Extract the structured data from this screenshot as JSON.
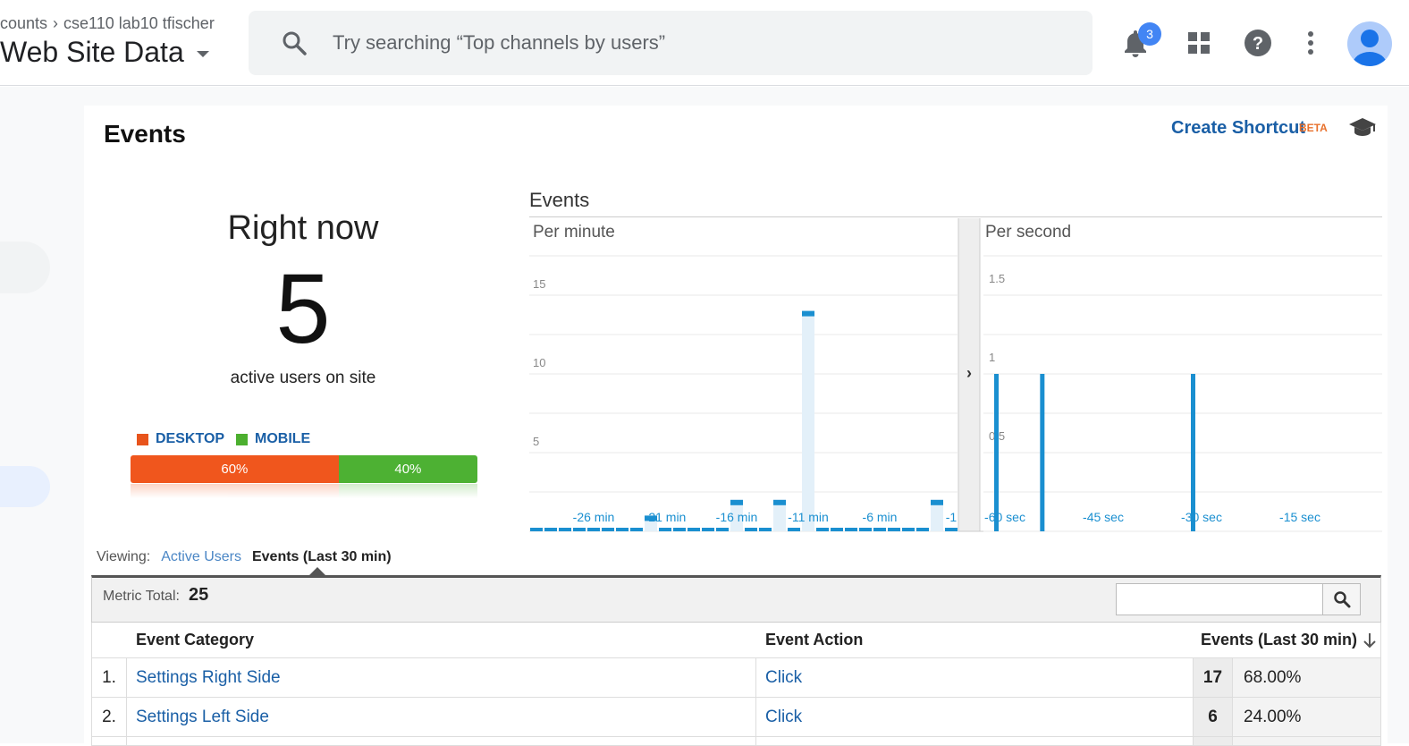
{
  "header": {
    "breadcrumb": [
      "counts",
      "cse110 lab10 tfischer"
    ],
    "property_name": "Web Site Data",
    "search_placeholder": "Try searching “Top channels by users”",
    "notification_count": "3"
  },
  "report": {
    "title": "Events",
    "create_shortcut": "Create Shortcut",
    "beta": "BETA"
  },
  "right_now": {
    "title": "Right now",
    "value": "5",
    "subtitle": "active users on site",
    "legend": [
      {
        "label": "DESKTOP",
        "color": "#e8541c"
      },
      {
        "label": "MOBILE",
        "color": "#4caf2f"
      }
    ],
    "split": [
      {
        "label": "60%",
        "value": 0.6,
        "color": "#f0561d"
      },
      {
        "label": "40%",
        "value": 0.4,
        "color": "#4db133"
      }
    ]
  },
  "chart_data": [
    {
      "type": "bar",
      "title": "Events",
      "panel_label": "Per minute",
      "yticks": [
        "5",
        "10",
        "15"
      ],
      "ylim": [
        0,
        15
      ],
      "xticks": [
        "-26 min",
        "-21 min",
        "-16 min",
        "-11 min",
        "-6 min",
        "-1"
      ],
      "x": [
        -30,
        -29,
        -28,
        -27,
        -26,
        -25,
        -24,
        -23,
        -22,
        -21,
        -20,
        -19,
        -18,
        -17,
        -16,
        -15,
        -14,
        -13,
        -12,
        -11,
        -10,
        -9,
        -8,
        -7,
        -6,
        -5,
        -4,
        -3,
        -2,
        -1
      ],
      "values": [
        0,
        0,
        0,
        0,
        0,
        0,
        0,
        0,
        1,
        0,
        0,
        0,
        0,
        0,
        2,
        0,
        0,
        2,
        0,
        14,
        0,
        0,
        0,
        0,
        0,
        0,
        0,
        0,
        2,
        0
      ]
    },
    {
      "type": "bar",
      "panel_label": "Per second",
      "yticks": [
        "0.5",
        "1",
        "1.5"
      ],
      "ylim": [
        0,
        1.5
      ],
      "xticks": [
        "-60 sec",
        "-45 sec",
        "-30 sec",
        "-15 sec"
      ],
      "x": [
        -60,
        -53,
        -30
      ],
      "values": [
        1,
        1,
        1
      ]
    }
  ],
  "viewing": {
    "label": "Viewing:",
    "options": [
      "Active Users",
      "Events (Last 30 min)"
    ]
  },
  "metric": {
    "label": "Metric Total:",
    "value": "25"
  },
  "table": {
    "columns": [
      "Event Category",
      "Event Action",
      "Events (Last 30 min)"
    ],
    "rows": [
      {
        "idx": "1.",
        "category": "Settings Right Side",
        "action": "Click",
        "events": "17",
        "pct": "68.00%"
      },
      {
        "idx": "2.",
        "category": "Settings Left Side",
        "action": "Click",
        "events": "6",
        "pct": "24.00%"
      }
    ]
  },
  "colors": {
    "bar_blue": "#1a8fd0",
    "link_blue": "#1a5fa6"
  }
}
